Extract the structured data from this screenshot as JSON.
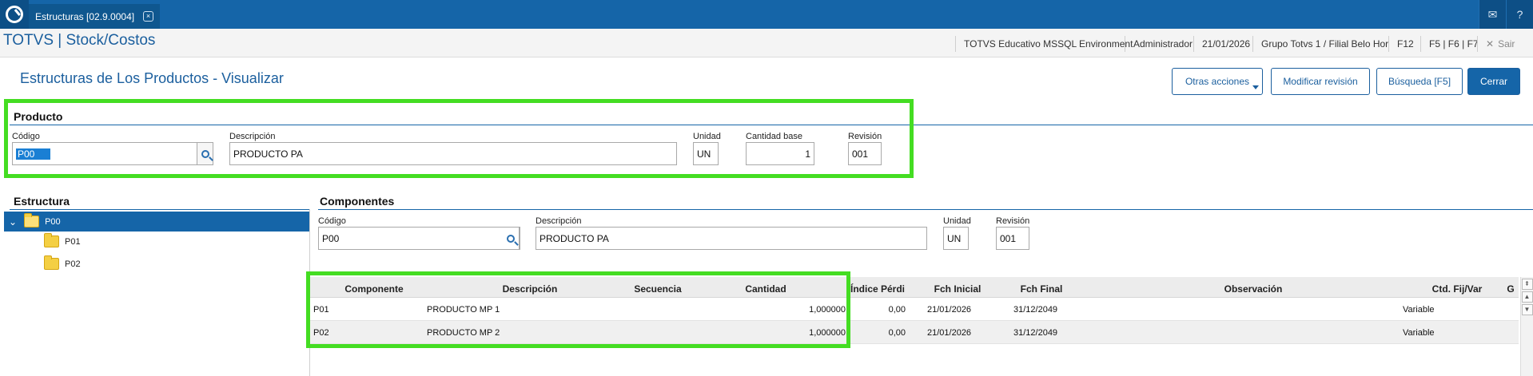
{
  "topbar": {
    "tab_label": "Estructuras [02.9.0004]",
    "close_glyph": "×",
    "mail_glyph": "✉",
    "help_glyph": "?"
  },
  "header": {
    "app_title": "TOTVS | Stock/Costos",
    "environment": "TOTVS Educativo MSSQL Environment",
    "user": "Administrador",
    "date": "21/01/2026",
    "branch": "Grupo Totvs 1 / Filial Belo Hor",
    "key_f12": "F12",
    "keys_f5_f7": "F5 | F6 | F7",
    "exit_label": "Sair"
  },
  "page": {
    "title": "Estructuras de Los Productos - Visualizar"
  },
  "toolbar": {
    "other_actions": "Otras acciones",
    "modify_revision": "Modificar revisión",
    "search": "Búsqueda [F5]",
    "close": "Cerrar"
  },
  "producto": {
    "section_title": "Producto",
    "codigo_label": "Código",
    "codigo_value": "P00",
    "descripcion_label": "Descripción",
    "descripcion_value": "PRODUCTO PA",
    "unidad_label": "Unidad",
    "unidad_value": "UN",
    "cantidad_label": "Cantidad base",
    "cantidad_value": "1",
    "revision_label": "Revisión",
    "revision_value": "001"
  },
  "estructura": {
    "section_title": "Estructura",
    "expand_glyph": "⌄",
    "items": [
      {
        "label": "P00"
      },
      {
        "label": "P01"
      },
      {
        "label": "P02"
      }
    ]
  },
  "componentes": {
    "section_title": "Componentes",
    "codigo_label": "Código",
    "codigo_value": "P00",
    "descripcion_label": "Descripción",
    "descripcion_value": "PRODUCTO PA",
    "unidad_label": "Unidad",
    "unidad_value": "UN",
    "revision_label": "Revisión",
    "revision_value": "001"
  },
  "grid": {
    "columns": [
      "Componente",
      "Descripción",
      "Secuencia",
      "Cantidad",
      "Índice Pérdi",
      "Fch Inicial",
      "Fch Final",
      "Observación",
      "Ctd. Fij/Var",
      "G"
    ],
    "rows": [
      {
        "componente": "P01",
        "descripcion": "PRODUCTO MP 1",
        "secuencia": "",
        "cantidad": "1,000000",
        "indice": "0,00",
        "fch_inicial": "21/01/2026",
        "fch_final": "31/12/2049",
        "observacion": "",
        "ctd": "Variable"
      },
      {
        "componente": "P02",
        "descripcion": "PRODUCTO MP 2",
        "secuencia": "",
        "cantidad": "1,000000",
        "indice": "0,00",
        "fch_inicial": "21/01/2026",
        "fch_final": "31/12/2049",
        "observacion": "",
        "ctd": "Variable"
      }
    ]
  },
  "colors": {
    "brand_blue": "#1565a8",
    "highlight_green": "#44dd22"
  }
}
